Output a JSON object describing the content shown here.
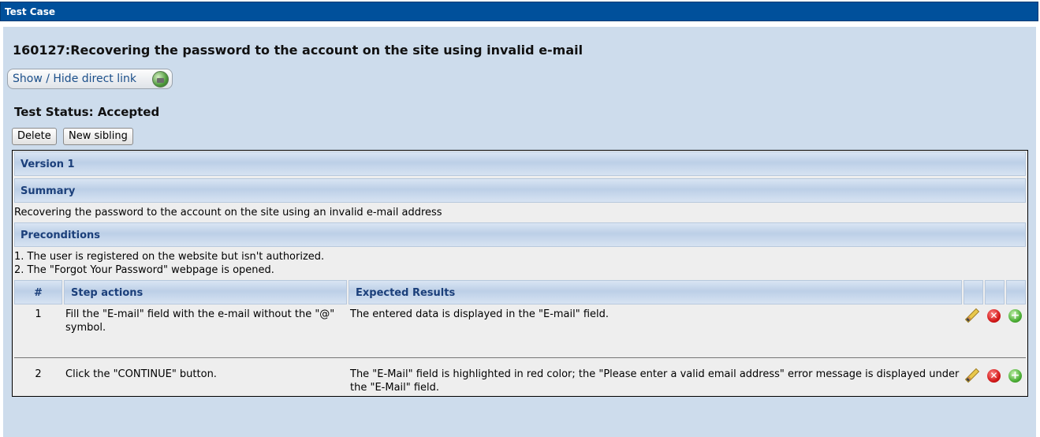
{
  "window": {
    "title": "Test Case"
  },
  "testcase": {
    "title": "160127:Recovering the password to the account on the site using invalid e-mail",
    "direct_link_label": "Show / Hide direct link",
    "status_line": "Test Status: Accepted"
  },
  "actions": {
    "delete_label": "Delete",
    "new_sibling_label": "New sibling"
  },
  "version": {
    "label": "Version 1"
  },
  "summary": {
    "label": "Summary",
    "text": "Recovering the password to the account on the site using an invalid e-mail address"
  },
  "preconditions": {
    "label": "Preconditions",
    "lines": [
      "1. The user is registered on the website but isn't authorized.",
      "2.  The \"Forgot Your Password\" webpage is opened."
    ]
  },
  "steps": {
    "headers": {
      "num": "#",
      "actions": "Step actions",
      "results": "Expected Results"
    },
    "rows": [
      {
        "num": "1",
        "action": "Fill the \"E-mail\" field with the e-mail without the \"@\" symbol.",
        "result": "The entered data is displayed in the \"E-mail\" field."
      },
      {
        "num": "2",
        "action": "Click the \"CONTINUE\" button.",
        "result": "The \"E-Mail\" field is highlighted in red color; the \"Please enter a valid email address\" error message is displayed under the \"E-Mail\" field."
      }
    ]
  },
  "icons": {
    "edit": "pencil-icon",
    "delete": "delete-icon",
    "add": "add-icon",
    "link": "globe-link-icon"
  },
  "colors": {
    "title_bar": "#00509b",
    "panel_bg": "#cddcec",
    "header_text": "#1b3f7a"
  }
}
